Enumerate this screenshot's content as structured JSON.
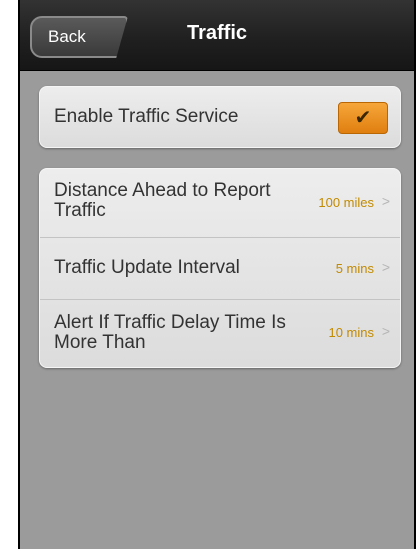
{
  "header": {
    "back_label": "Back",
    "title": "Traffic"
  },
  "enable": {
    "label": "Enable Traffic Service",
    "checked": true,
    "check_icon": "checkmark-icon"
  },
  "settings": [
    {
      "label": "Distance Ahead to Report Traffic",
      "value": "100 miles"
    },
    {
      "label": "Traffic Update Interval",
      "value": "5 mins"
    },
    {
      "label": "Alert If Traffic Delay Time Is More Than",
      "value": "10 mins"
    }
  ],
  "colors": {
    "accent": "#f0921e",
    "value_text": "#c28a00",
    "background": "#9b9b9b"
  }
}
